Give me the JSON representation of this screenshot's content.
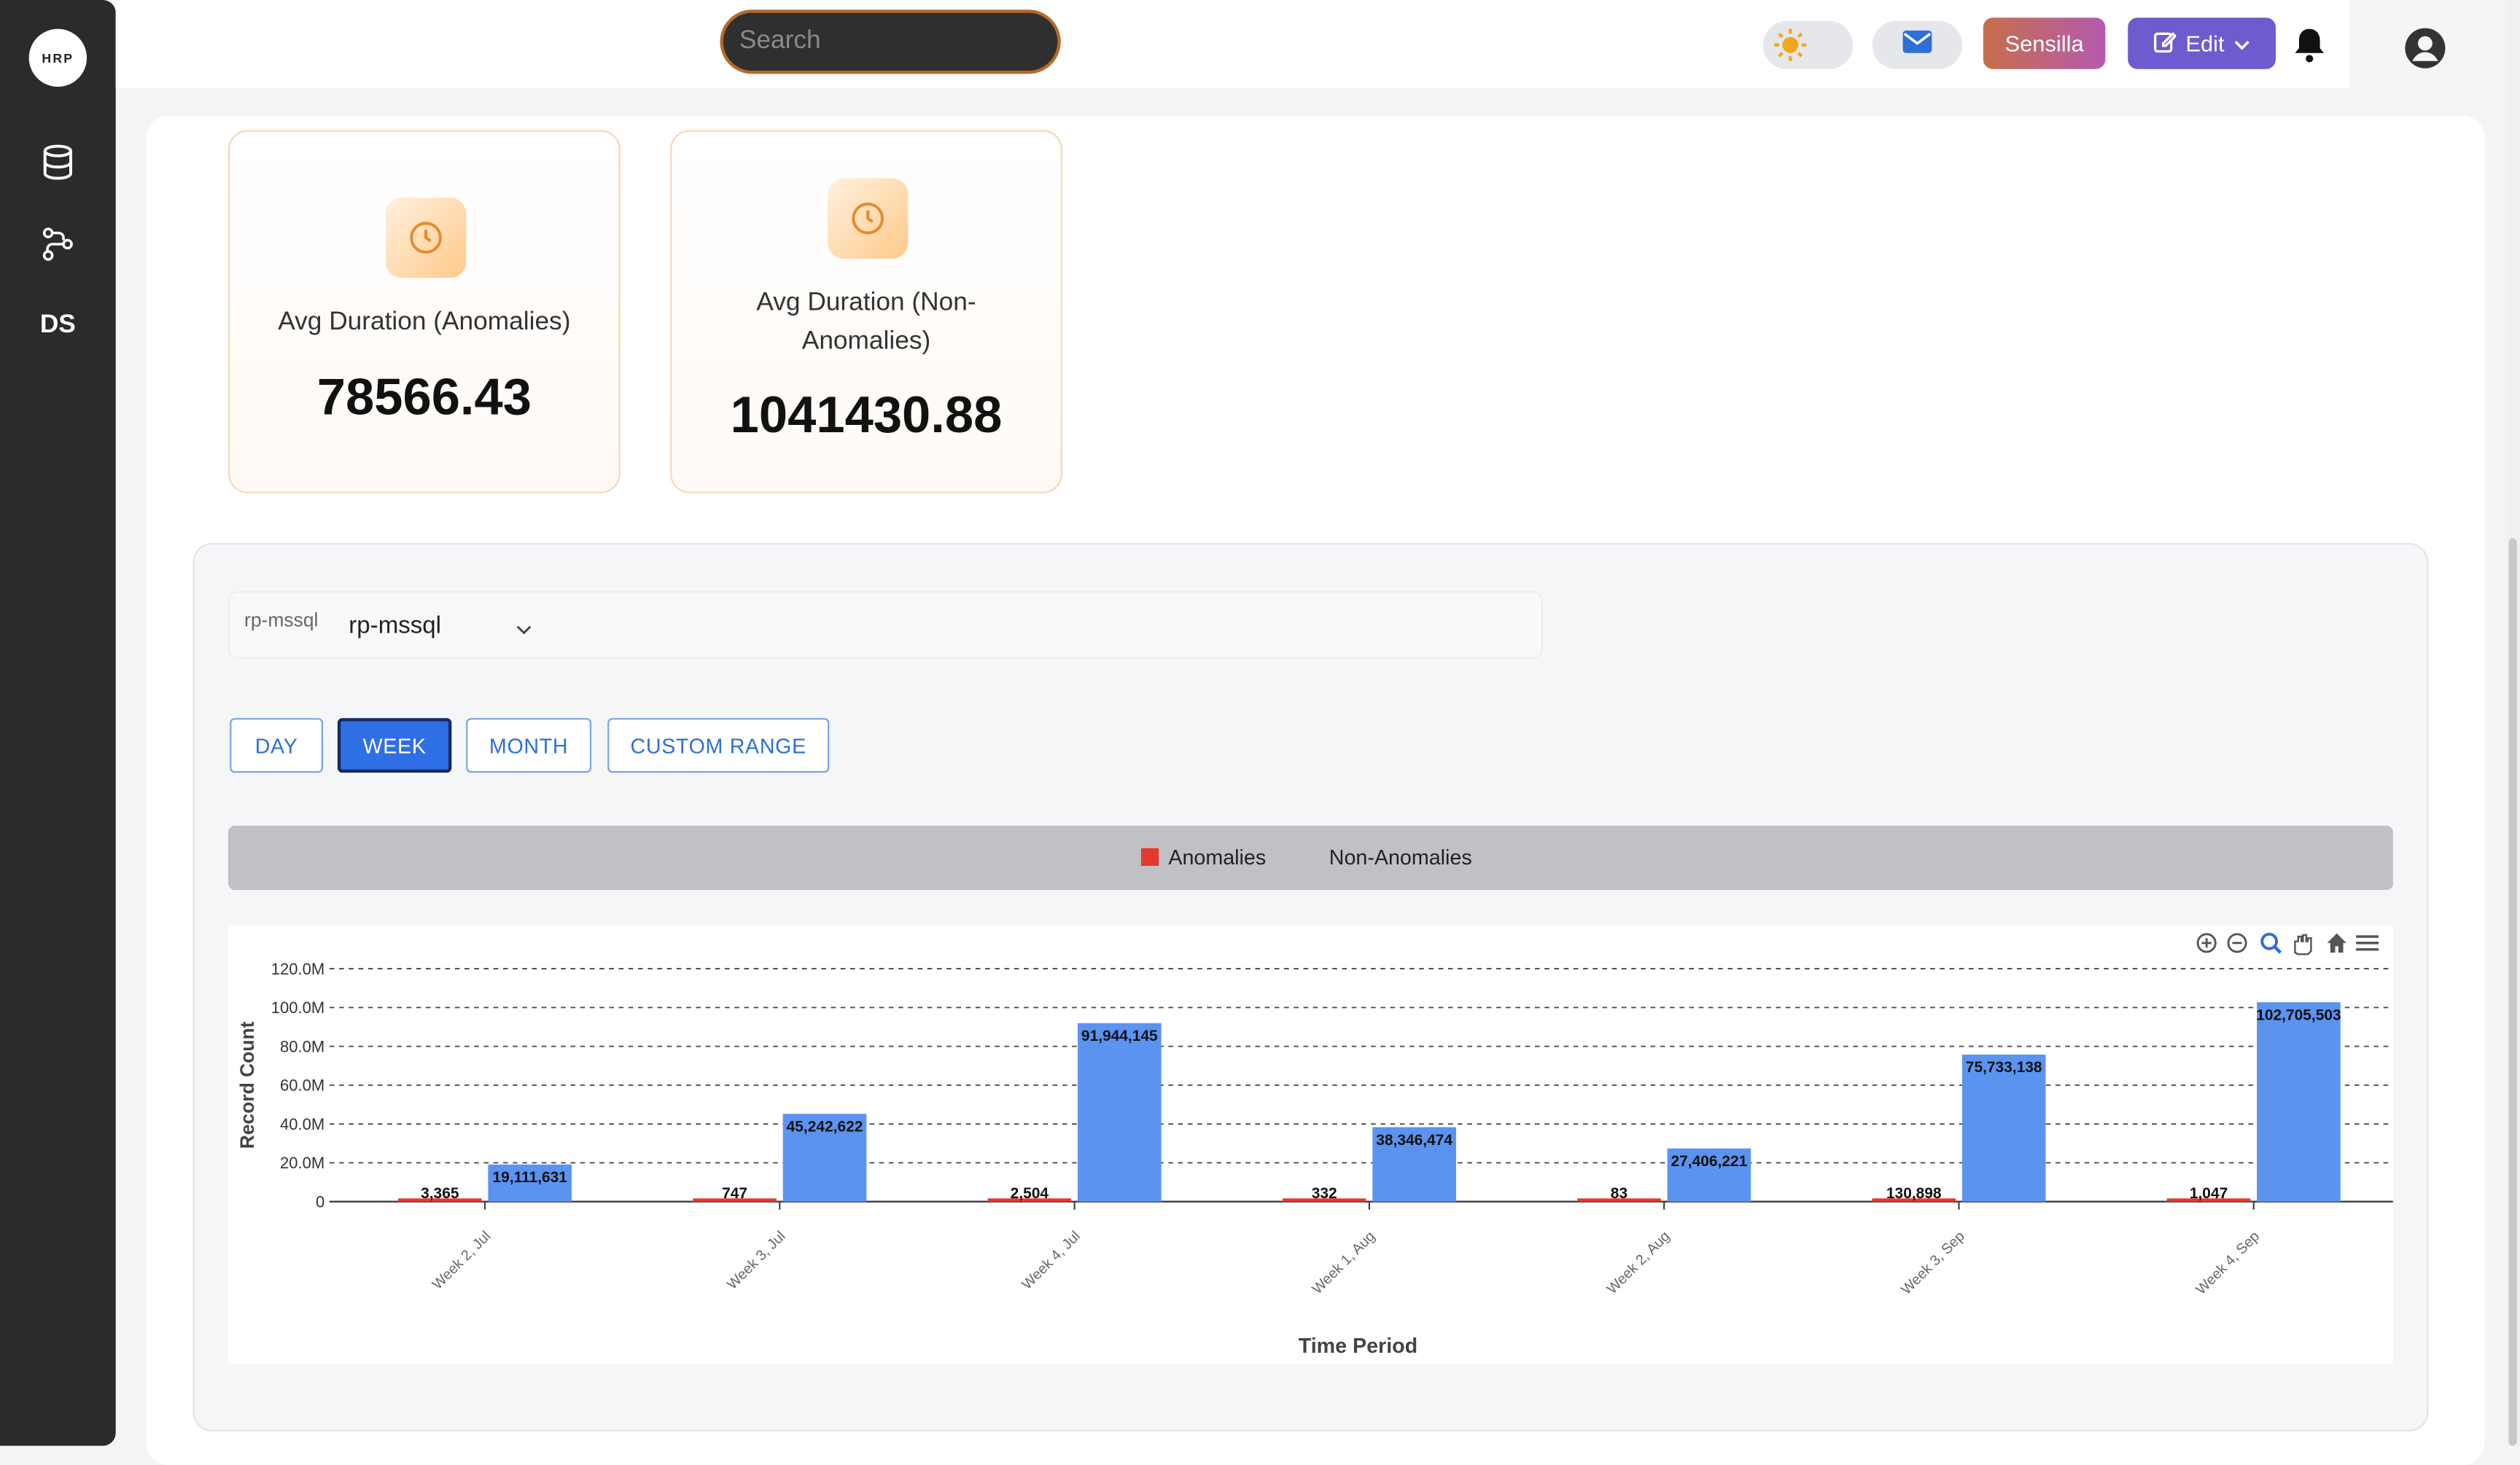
{
  "sidebar": {
    "logo_text": "HRP",
    "items": [
      {
        "icon": "database-icon"
      },
      {
        "icon": "workflow-icon"
      },
      {
        "label": "DS"
      }
    ]
  },
  "header": {
    "search_placeholder": "Search",
    "theme_icon": "sun-icon",
    "mail_icon": "mail-icon",
    "sensilla_label": "Sensilla",
    "edit_label": "Edit",
    "bell_icon": "bell-icon",
    "profile_icon": "user-circle-icon",
    "colors": {
      "edit": "#6d5bd0",
      "sensilla_start": "#c76f4b",
      "sensilla_end": "#b45ab0"
    }
  },
  "cards": [
    {
      "label": "Avg Duration (Anomalies)",
      "value": "78566.43",
      "icon": "clock-icon"
    },
    {
      "label_line1": "Avg Duration (Non-",
      "label_line2": "Anomalies)",
      "value": "1041430.88",
      "icon": "clock-icon"
    }
  ],
  "datasource": {
    "label": "rp-mssql",
    "value": "rp-mssql"
  },
  "tabs": [
    {
      "label": "DAY",
      "active": false
    },
    {
      "label": "WEEK",
      "active": true
    },
    {
      "label": "MONTH",
      "active": false
    },
    {
      "label": "CUSTOM RANGE",
      "active": false
    }
  ],
  "legend": {
    "anomalies": "Anomalies",
    "non_anomalies": "Non-Anomalies"
  },
  "chart_data": {
    "type": "bar",
    "xlabel": "Time Period",
    "ylabel": "Record Count",
    "ylim": [
      0,
      120000000
    ],
    "yticks": [
      "0",
      "20.0M",
      "40.0M",
      "60.0M",
      "80.0M",
      "100.0M",
      "120.0M"
    ],
    "grid": true,
    "categories": [
      "Week 2, Jul",
      "Week 3, Jul",
      "Week 4, Jul",
      "Week 1, Aug",
      "Week 2, Aug",
      "Week 3, Sep",
      "Week 4, Sep"
    ],
    "series": [
      {
        "name": "Anomalies",
        "color": "#e23b2e",
        "values": [
          3365,
          747,
          2504,
          332,
          83,
          130898,
          1047
        ],
        "labels": [
          "3,365",
          "747",
          "2,504",
          "332",
          "83",
          "130,898",
          "1,047"
        ]
      },
      {
        "name": "Non-Anomalies",
        "color": "#5b93f0",
        "values": [
          19111631,
          45242622,
          91944145,
          38346474,
          27406221,
          75733138,
          102705503
        ],
        "labels": [
          "19,111,631",
          "45,242,622",
          "91,944,145",
          "38,346,474",
          "27,406,221",
          "75,733,138",
          "102,705,503"
        ]
      }
    ],
    "toolbar": [
      "zoom-in-icon",
      "zoom-out-icon",
      "selection-zoom-icon",
      "pan-icon",
      "reset-home-icon",
      "menu-icon"
    ]
  }
}
